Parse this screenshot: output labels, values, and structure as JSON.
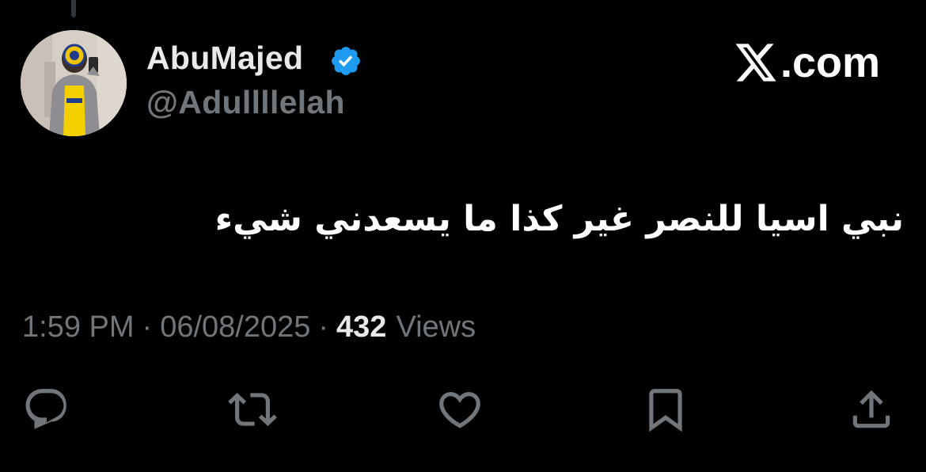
{
  "author": {
    "display_name": "AbuMajed",
    "handle": "@Adullllelah",
    "verified": true,
    "verified_color": "#1d9bf0"
  },
  "site_label": ".com",
  "tweet": {
    "text": "نبي اسيا للنصر غير كذا ما يسعدني شيء"
  },
  "meta": {
    "time": "1:59 PM",
    "separator": "·",
    "date": "06/08/2025",
    "views_count": "432",
    "views_label": "Views"
  },
  "actions": [
    {
      "name": "reply",
      "icon": "reply-icon"
    },
    {
      "name": "repost",
      "icon": "repost-icon"
    },
    {
      "name": "like",
      "icon": "heart-icon"
    },
    {
      "name": "bookmark",
      "icon": "bookmark-icon"
    },
    {
      "name": "share",
      "icon": "share-icon"
    }
  ],
  "colors": {
    "background": "#000000",
    "primary_text": "#e7e9ea",
    "secondary_text": "#71767b",
    "icon": "#71767b"
  }
}
